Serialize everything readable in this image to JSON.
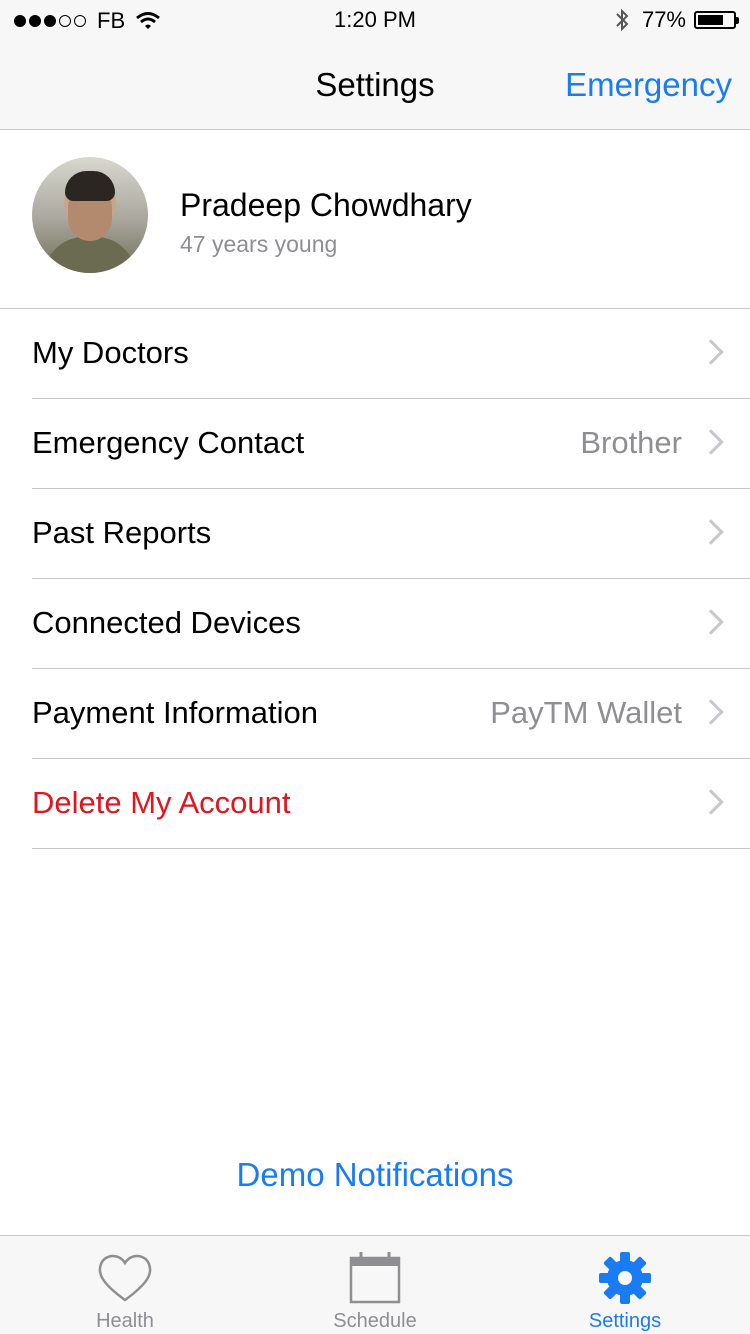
{
  "status_bar": {
    "carrier": "FB",
    "time": "1:20 PM",
    "battery": "77%",
    "signal_filled": 3,
    "signal_total": 5
  },
  "nav": {
    "title": "Settings",
    "right_action": "Emergency"
  },
  "profile": {
    "name": "Pradeep Chowdhary",
    "subtitle": "47 years young"
  },
  "settings_rows": [
    {
      "label": "My Doctors",
      "value": ""
    },
    {
      "label": "Emergency Contact",
      "value": "Brother"
    },
    {
      "label": "Past Reports",
      "value": ""
    },
    {
      "label": "Connected Devices",
      "value": ""
    },
    {
      "label": "Payment Information",
      "value": "PayTM Wallet"
    },
    {
      "label": "Delete My Account",
      "value": ""
    }
  ],
  "demo_link": "Demo Notifications",
  "tabs": [
    {
      "label": "Health",
      "icon": "heart-icon",
      "active": false
    },
    {
      "label": "Schedule",
      "icon": "calendar-icon",
      "active": false
    },
    {
      "label": "Settings",
      "icon": "gear-icon",
      "active": true
    }
  ],
  "colors": {
    "accent": "#1a7cf2",
    "danger": "#e2151f",
    "secondary_text": "#8e8e93",
    "separator": "#c8c7cc"
  }
}
